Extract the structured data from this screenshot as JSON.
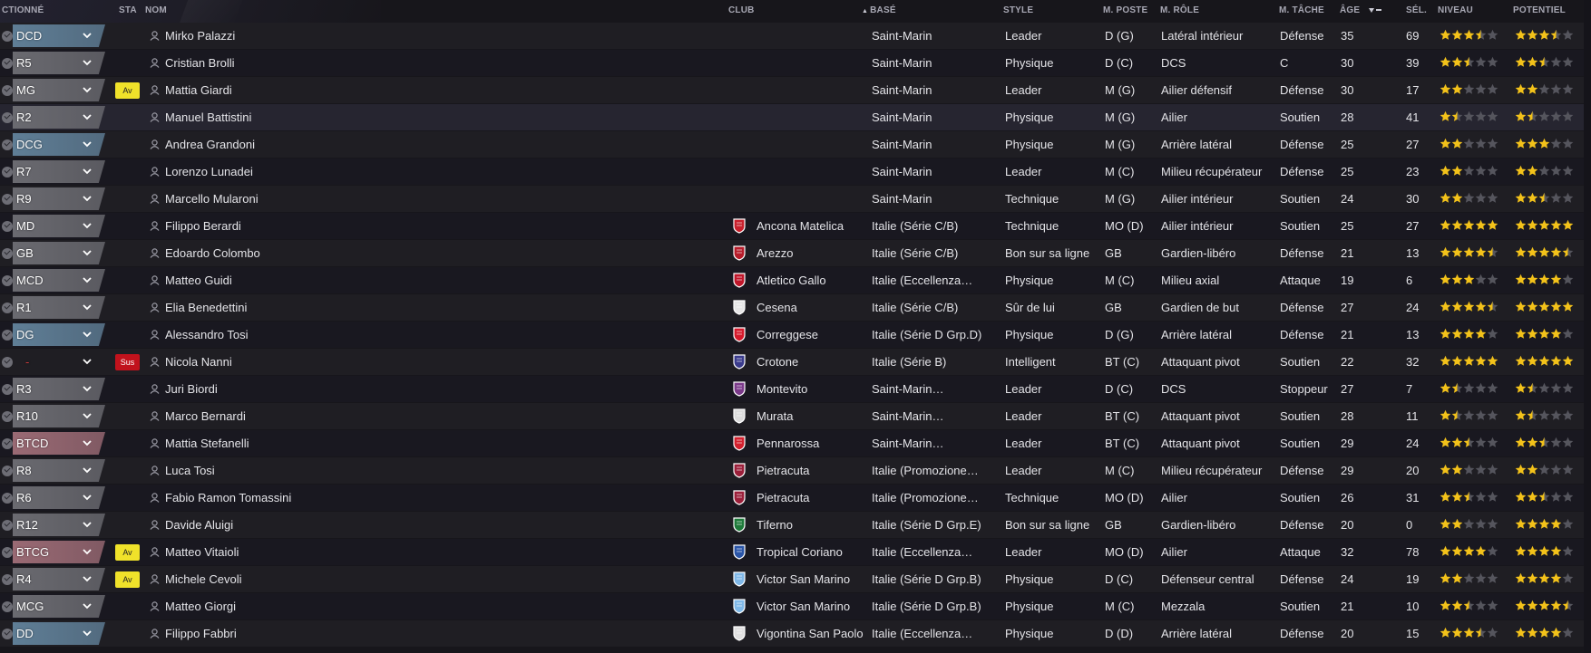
{
  "headers": {
    "position": "CTIONNÉ",
    "status": "STA",
    "name": "NOM",
    "club": "CLUB",
    "based": "BASÉ",
    "style": "STYLE",
    "pos": "M. POSTE",
    "role": "M. RÔLE",
    "duty": "M. TÂCHE",
    "age": "ÂGE",
    "caps": "SÉL.",
    "ability": "NIVEAU",
    "potential": "POTENTIEL"
  },
  "colors": {
    "accent_star": "#f3c21a",
    "empty_star": "#55555d",
    "badge_av": "#f0e22a",
    "badge_sus": "#c1121c",
    "row_highlight": "#262530"
  },
  "players": [
    {
      "position": "DCD",
      "pos_color": "#5f7e96",
      "status": "",
      "name": "Mirko Palazzi",
      "club": "",
      "crest": null,
      "based": "Saint-Marin",
      "style": "Leader",
      "pos": "D (G)",
      "role": "Latéral intérieur",
      "duty": "Défense",
      "age": "35",
      "caps": "69",
      "ability": 3.5,
      "potential": 3.5
    },
    {
      "position": "R5",
      "pos_color": "#6a6a70",
      "status": "",
      "name": "Cristian Brolli",
      "club": "",
      "crest": null,
      "based": "Saint-Marin",
      "style": "Physique",
      "pos": "D (C)",
      "role": "DCS",
      "duty": "C",
      "age": "30",
      "caps": "39",
      "ability": 2.5,
      "potential": 2.5
    },
    {
      "position": "MG",
      "pos_color": "#6a6a70",
      "status": "Av",
      "name": "Mattia Giardi",
      "club": "",
      "crest": null,
      "based": "Saint-Marin",
      "style": "Leader",
      "pos": "M (G)",
      "role": "Ailier défensif",
      "duty": "Défense",
      "age": "30",
      "caps": "17",
      "ability": 2,
      "potential": 2
    },
    {
      "position": "R2",
      "pos_color": "#6a6a70",
      "status": "",
      "name": "Manuel Battistini",
      "club": "",
      "crest": null,
      "based": "Saint-Marin",
      "style": "Physique",
      "pos": "M (G)",
      "role": "Ailier",
      "duty": "Soutien",
      "age": "28",
      "caps": "41",
      "ability": 1.5,
      "potential": 1.5
    },
    {
      "position": "DCG",
      "pos_color": "#5f7e96",
      "status": "",
      "name": "Andrea Grandoni",
      "club": "",
      "crest": null,
      "based": "Saint-Marin",
      "style": "Physique",
      "pos": "M (G)",
      "role": "Arrière latéral",
      "duty": "Défense",
      "age": "25",
      "caps": "27",
      "ability": 2,
      "potential": 3
    },
    {
      "position": "R7",
      "pos_color": "#6a6a70",
      "status": "",
      "name": "Lorenzo Lunadei",
      "club": "",
      "crest": null,
      "based": "Saint-Marin",
      "style": "Leader",
      "pos": "M (C)",
      "role": "Milieu récupérateur",
      "duty": "Défense",
      "age": "25",
      "caps": "23",
      "ability": 2,
      "potential": 2
    },
    {
      "position": "R9",
      "pos_color": "#6a6a70",
      "status": "",
      "name": "Marcello Mularoni",
      "club": "",
      "crest": null,
      "based": "Saint-Marin",
      "style": "Technique",
      "pos": "M (G)",
      "role": "Ailier intérieur",
      "duty": "Soutien",
      "age": "24",
      "caps": "30",
      "ability": 2,
      "potential": 2.5
    },
    {
      "position": "MD",
      "pos_color": "#6a6a70",
      "status": "",
      "name": "Filippo Berardi",
      "club": "Ancona Matelica",
      "crest": "#c8202c",
      "based": "Italie (Série C/B)",
      "style": "Technique",
      "pos": "MO (D)",
      "role": "Ailier intérieur",
      "duty": "Soutien",
      "age": "25",
      "caps": "27",
      "ability": 5,
      "potential": 5
    },
    {
      "position": "GB",
      "pos_color": "#6a6a70",
      "status": "",
      "name": "Edoardo Colombo",
      "club": "Arezzo",
      "crest": "#b71c2a",
      "based": "Italie (Série C/B)",
      "style": "Bon sur sa ligne",
      "pos": "GB",
      "role": "Gardien-libéro",
      "duty": "Défense",
      "age": "21",
      "caps": "13",
      "ability": 4.5,
      "potential": 4.5
    },
    {
      "position": "MCD",
      "pos_color": "#6a6a70",
      "status": "",
      "name": "Matteo Guidi",
      "club": "Atletico Gallo",
      "crest": "#c0162a",
      "based": "Italie (Eccellenza…",
      "style": "Physique",
      "pos": "M (C)",
      "role": "Milieu axial",
      "duty": "Attaque",
      "age": "19",
      "caps": "6",
      "ability": 3,
      "potential": 4
    },
    {
      "position": "R1",
      "pos_color": "#6a6a70",
      "status": "",
      "name": "Elia Benedettini",
      "club": "Cesena",
      "crest": "#e6e6e6",
      "based": "Italie (Série C/B)",
      "style": "Sûr de lui",
      "pos": "GB",
      "role": "Gardien de but",
      "duty": "Défense",
      "age": "27",
      "caps": "24",
      "ability": 4.5,
      "potential": 5
    },
    {
      "position": "DG",
      "pos_color": "#5f7e96",
      "status": "",
      "name": "Alessandro Tosi",
      "club": "Correggese",
      "crest": "#d5192b",
      "based": "Italie (Série D Grp.D)",
      "style": "Physique",
      "pos": "D (G)",
      "role": "Arrière latéral",
      "duty": "Défense",
      "age": "21",
      "caps": "13",
      "ability": 4,
      "potential": 4
    },
    {
      "position": "-",
      "pos_color": "",
      "status": "Sus",
      "name": "Nicola Nanni",
      "club": "Crotone",
      "crest": "#3a3b8c",
      "based": "Italie (Série B)",
      "style": "Intelligent",
      "pos": "BT (C)",
      "role": "Attaquant pivot",
      "duty": "Soutien",
      "age": "22",
      "caps": "32",
      "ability": 5,
      "potential": 5
    },
    {
      "position": "R3",
      "pos_color": "#6a6a70",
      "status": "",
      "name": "Juri Biordi",
      "club": "Montevito",
      "crest": "#7b3a8a",
      "based": "Saint-Marin…",
      "style": "Leader",
      "pos": "D (C)",
      "role": "DCS",
      "duty": "Stoppeur",
      "age": "27",
      "caps": "7",
      "ability": 1.5,
      "potential": 1.5
    },
    {
      "position": "R10",
      "pos_color": "#6a6a70",
      "status": "",
      "name": "Marco Bernardi",
      "club": "Murata",
      "crest": "#dcdcdc",
      "based": "Saint-Marin…",
      "style": "Leader",
      "pos": "BT (C)",
      "role": "Attaquant pivot",
      "duty": "Soutien",
      "age": "28",
      "caps": "11",
      "ability": 1.5,
      "potential": 1.5
    },
    {
      "position": "BTCD",
      "pos_color": "#9a6a74",
      "status": "",
      "name": "Mattia Stefanelli",
      "club": "Pennarossa",
      "crest": "#d3202e",
      "based": "Saint-Marin…",
      "style": "Leader",
      "pos": "BT (C)",
      "role": "Attaquant pivot",
      "duty": "Soutien",
      "age": "29",
      "caps": "24",
      "ability": 2.5,
      "potential": 2.5
    },
    {
      "position": "R8",
      "pos_color": "#6a6a70",
      "status": "",
      "name": "Luca Tosi",
      "club": "Pietracuta",
      "crest": "#9b1f3a",
      "based": "Italie (Promozione…",
      "style": "Leader",
      "pos": "M (C)",
      "role": "Milieu récupérateur",
      "duty": "Défense",
      "age": "29",
      "caps": "20",
      "ability": 2,
      "potential": 2
    },
    {
      "position": "R6",
      "pos_color": "#6a6a70",
      "status": "",
      "name": "Fabio Ramon Tomassini",
      "club": "Pietracuta",
      "crest": "#9b1f3a",
      "based": "Italie (Promozione…",
      "style": "Technique",
      "pos": "MO (D)",
      "role": "Ailier",
      "duty": "Soutien",
      "age": "26",
      "caps": "31",
      "ability": 2.5,
      "potential": 2.5
    },
    {
      "position": "R12",
      "pos_color": "#6a6a70",
      "status": "",
      "name": "Davide Aluigi",
      "club": "Tiferno",
      "crest": "#1e7a3a",
      "based": "Italie (Série D Grp.E)",
      "style": "Bon sur sa ligne",
      "pos": "GB",
      "role": "Gardien-libéro",
      "duty": "Défense",
      "age": "20",
      "caps": "0",
      "ability": 2,
      "potential": 4
    },
    {
      "position": "BTCG",
      "pos_color": "#9a6a74",
      "status": "Av",
      "name": "Matteo Vitaioli",
      "club": "Tropical Coriano",
      "crest": "#2a55a8",
      "based": "Italie (Eccellenza…",
      "style": "Leader",
      "pos": "MO (D)",
      "role": "Ailier",
      "duty": "Attaque",
      "age": "32",
      "caps": "78",
      "ability": 4,
      "potential": 4
    },
    {
      "position": "R4",
      "pos_color": "#6a6a70",
      "status": "Av",
      "name": "Michele Cevoli",
      "club": "Victor San Marino",
      "crest": "#7fb8e8",
      "based": "Italie (Série D Grp.B)",
      "style": "Physique",
      "pos": "D (C)",
      "role": "Défenseur central",
      "duty": "Défense",
      "age": "24",
      "caps": "19",
      "ability": 2,
      "potential": 4
    },
    {
      "position": "MCG",
      "pos_color": "#6a6a70",
      "status": "",
      "name": "Matteo Giorgi",
      "club": "Victor San Marino",
      "crest": "#7fb8e8",
      "based": "Italie (Série D Grp.B)",
      "style": "Physique",
      "pos": "M (C)",
      "role": "Mezzala",
      "duty": "Soutien",
      "age": "21",
      "caps": "10",
      "ability": 2.5,
      "potential": 4.5
    },
    {
      "position": "DD",
      "pos_color": "#5f7e96",
      "status": "",
      "name": "Filippo Fabbri",
      "club": "Vigontina San Paolo",
      "crest": "#e0e0e0",
      "based": "Italie (Eccellenza…",
      "style": "Physique",
      "pos": "D (D)",
      "role": "Arrière latéral",
      "duty": "Défense",
      "age": "20",
      "caps": "15",
      "ability": 3.5,
      "potential": 4
    }
  ]
}
